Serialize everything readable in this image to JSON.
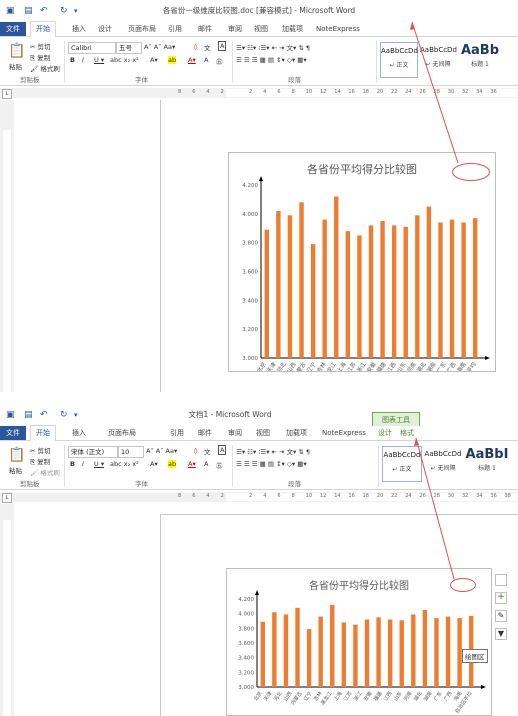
{
  "window1": {
    "title": "各省份一级维度比较图.doc [兼容模式] - Microsoft Word",
    "tabs": [
      {
        "label": "文件",
        "kind": "file"
      },
      {
        "label": "开始",
        "kind": "active"
      },
      {
        "label": "插入"
      },
      {
        "label": "设计"
      },
      {
        "label": "页面布局"
      },
      {
        "label": "引用"
      },
      {
        "label": "邮件"
      },
      {
        "label": "审阅"
      },
      {
        "label": "视图"
      },
      {
        "label": "加载项"
      },
      {
        "label": "NoteExpress"
      }
    ],
    "clipboard": {
      "paste": "粘贴",
      "cut": "剪切",
      "copy": "复制",
      "format_painter": "格式刷",
      "group": "剪贴板"
    },
    "font": {
      "name": "Calibri",
      "size": "五号",
      "group": "字体"
    },
    "paragraph_group": "段落",
    "styles": [
      {
        "preview": "AaBbCcDd",
        "name": "正文"
      },
      {
        "preview": "AaBbCcDd",
        "name": "无间隔"
      },
      {
        "preview": "AaBb",
        "name": "标题 1"
      }
    ],
    "ruler_numbers": [
      "8",
      "6",
      "4",
      "2",
      "",
      "2",
      "4",
      "6",
      "8",
      "10",
      "12",
      "14",
      "16",
      "18",
      "20",
      "22",
      "24",
      "26",
      "28",
      "30",
      "32",
      "34",
      "36"
    ]
  },
  "window2": {
    "title": "文档1 - Microsoft Word",
    "context_tab_group": "图表工具",
    "context_tabs": [
      "设计",
      "格式"
    ],
    "tabs": [
      {
        "label": "文件",
        "kind": "file"
      },
      {
        "label": "开始",
        "kind": "active"
      },
      {
        "label": "插入"
      },
      {
        "label": "页面布局"
      },
      {
        "label": "引用"
      },
      {
        "label": "邮件"
      },
      {
        "label": "审阅"
      },
      {
        "label": "视图"
      },
      {
        "label": "加载项"
      },
      {
        "label": "NoteExpress"
      }
    ],
    "clipboard": {
      "paste": "粘贴",
      "cut": "剪切",
      "copy": "复制",
      "format_painter": "格式刷",
      "group": "剪贴板"
    },
    "font": {
      "name": "宋体 (正文)",
      "size": "10",
      "group": "字体"
    },
    "paragraph_group": "段落",
    "styles": [
      {
        "preview": "AaBbCcDd",
        "name": "正文"
      },
      {
        "preview": "AaBbCcDd",
        "name": "无间隔"
      },
      {
        "preview": "AaBbI",
        "name": "标题 1"
      }
    ],
    "ruler_numbers": [
      "8",
      "6",
      "4",
      "2",
      "",
      "2",
      "4",
      "6",
      "8",
      "10",
      "12",
      "14",
      "16",
      "18",
      "20",
      "22",
      "24",
      "26",
      "28",
      "30",
      "32",
      "34",
      "36",
      "38"
    ],
    "tooltip": "绘图区"
  },
  "chart_data": [
    {
      "type": "bar",
      "title": "各省份平均得分比较图",
      "categories": [
        "北京",
        "天津",
        "河北",
        "山西",
        "内蒙古",
        "辽宁",
        "吉林",
        "黑龙江",
        "上海",
        "江苏",
        "浙江",
        "安徽",
        "福建",
        "江西",
        "山东",
        "河南",
        "湖北",
        "湖南",
        "广东",
        "广西",
        "海南",
        "自治区平均"
      ],
      "values": [
        3.89,
        4.02,
        3.99,
        4.08,
        3.79,
        3.96,
        4.12,
        3.88,
        3.85,
        3.92,
        3.95,
        3.92,
        3.91,
        3.99,
        4.05,
        3.94,
        3.96,
        3.94,
        3.97
      ],
      "yticks": [
        "3.000",
        "3.200",
        "3.400",
        "3.600",
        "3.800",
        "4.000",
        "4.200"
      ],
      "ylim": [
        3.0,
        4.2
      ],
      "color": "#ed7d31"
    },
    {
      "type": "bar",
      "title": "各省份平均得分比较图",
      "categories": [
        "北京",
        "天津",
        "河北",
        "山西",
        "内蒙古",
        "辽宁",
        "吉林",
        "黑龙江",
        "上海",
        "江苏",
        "浙江",
        "安徽",
        "福建",
        "江西",
        "山东",
        "河南",
        "湖北",
        "湖南",
        "广东",
        "广西",
        "海南",
        "自治区平均"
      ],
      "values": [
        3.89,
        4.02,
        3.99,
        4.08,
        3.79,
        3.96,
        4.12,
        3.88,
        3.85,
        3.92,
        3.95,
        3.92,
        3.91,
        3.99,
        4.05,
        3.94,
        3.96,
        3.94,
        3.97
      ],
      "yticks": [
        "3.000",
        "3.200",
        "3.400",
        "3.600",
        "3.800",
        "4.000",
        "4.200"
      ],
      "ylim": [
        3.0,
        4.2
      ],
      "color": "#ed7d31"
    }
  ],
  "colors": {
    "word_blue": "#2b579a",
    "bar": "#ed7d31",
    "annotation": "#d9534f",
    "context_tab": "#70ad47"
  }
}
